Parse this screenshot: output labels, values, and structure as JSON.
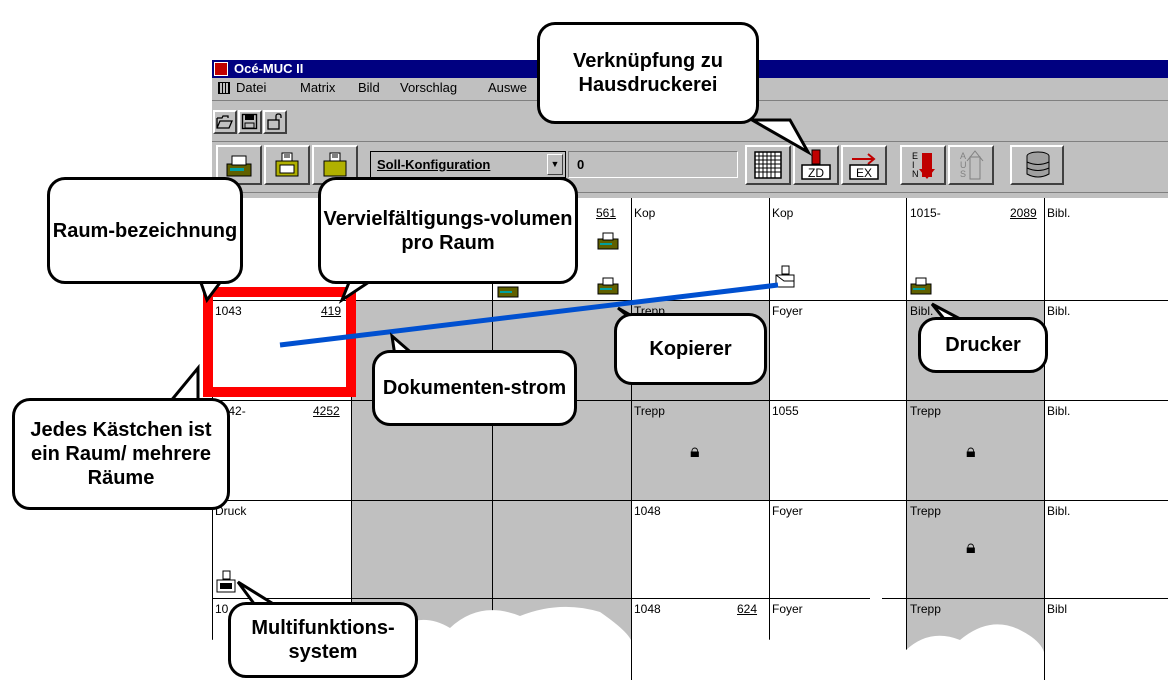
{
  "window": {
    "title": "Océ-MUC II",
    "menu": [
      "Datei",
      "Matrix",
      "Bild",
      "Vorschlag",
      "Auswe"
    ]
  },
  "toolbar": {
    "combo_value": "Soll-Konfiguration",
    "value_field": "0",
    "icons": [
      "open-icon",
      "save-icon",
      "unlock-icon",
      "printer-add-icon",
      "multifunction-icon",
      "copier-icon",
      "grid-icon",
      "zd-icon",
      "ex-icon",
      "ein-icon",
      "aus-icon",
      "database-icon"
    ],
    "zd_label": "ZD",
    "ex_label": "EX",
    "ein_label": "EIN",
    "aus_label": "AUS"
  },
  "grid": {
    "row1": {
      "c3_num": "561",
      "c4_label": "Kop",
      "c5_label": "Kop",
      "c6_label": "1015-",
      "c6_num": "2089",
      "c7_label": "Bibl."
    },
    "row2": {
      "c1_label": "1043",
      "c1_num": "419",
      "c4_label": "Trepp",
      "c5_label": "Foyer",
      "c6_label": "Bibl.",
      "c7_label": "Bibl."
    },
    "row3": {
      "c1_label": "1042-",
      "c1_num": "4252",
      "c4_label": "Trepp",
      "c5_label": "1055",
      "c6_label": "Trepp",
      "c7_label": "Bibl."
    },
    "row4": {
      "c1_label": "Druck",
      "c4_label": "1048",
      "c5_label": "Foyer",
      "c6_label": "Trepp",
      "c7_label": "Bibl."
    },
    "row5": {
      "c1_label": "10",
      "c4_label": "1048",
      "c4_num": "624",
      "c5_label": "Foyer",
      "c6_label": "Trepp",
      "c7_label": "Bibl"
    }
  },
  "callouts": {
    "hausdruckerei": "Verknüpfung zu Hausdruckerei",
    "raum": "Raum-bezeichnung",
    "volumen": "Vervielfältigungs-volumen pro Raum",
    "kopierer": "Kopierer",
    "drucker": "Drucker",
    "dokumentenstrom": "Dokumenten-strom",
    "kaestchen": "Jedes Kästchen ist ein Raum/ mehrere Räume",
    "multifunktion": "Multifunktions-system"
  },
  "colors": {
    "titlebar": "#000080",
    "highlight": "#ff0000",
    "flow": "#0050d0",
    "panel": "#c0c0c0"
  }
}
